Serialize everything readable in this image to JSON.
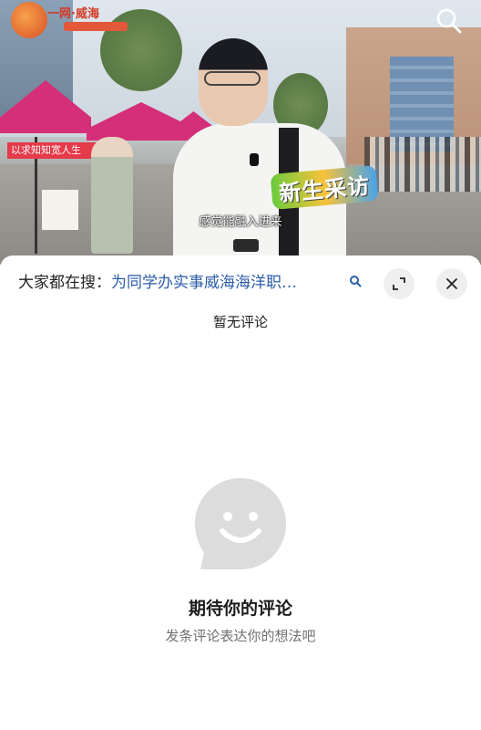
{
  "video": {
    "logo_text": "一网·威海",
    "banner_text": "以求知知宽人生",
    "sticker_text": "新生采访",
    "subtitle": "感觉能融入进来",
    "top_search_icon": "search-icon"
  },
  "sheet": {
    "search_prefix": "大家都在搜：",
    "search_query": "为同学办实事威海海洋职…",
    "search_icon": "search-icon",
    "expand_icon": "expand-icon",
    "close_icon": "close-icon",
    "no_comment": "暂无评论",
    "empty_icon": "comment-bubble-smile-icon",
    "empty_title": "期待你的评论",
    "empty_subtitle": "发条评论表达你的想法吧"
  },
  "colors": {
    "query_link": "#2b5da8",
    "tent": "#d42f78",
    "button_bg": "#efefef",
    "empty_icon": "#dcdcdc"
  }
}
